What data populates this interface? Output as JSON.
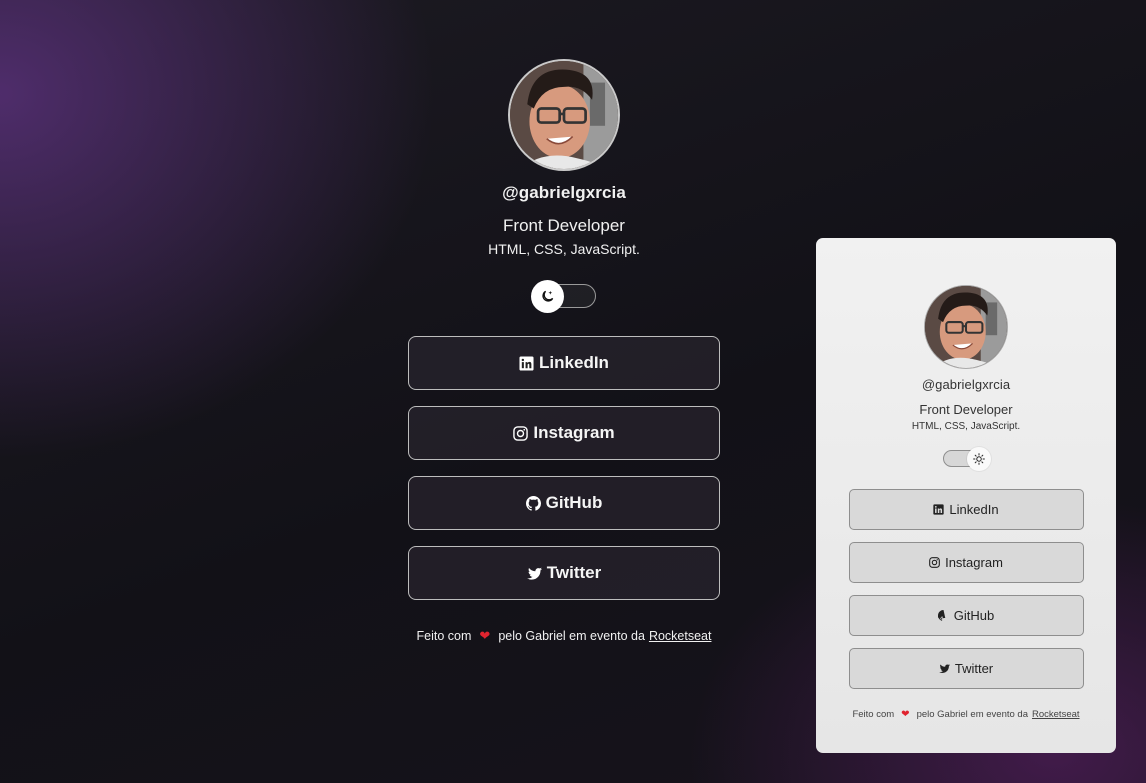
{
  "profile": {
    "handle": "@gabrielgxrcia",
    "role": "Front Developer",
    "stack": "HTML, CSS, JavaScript.",
    "avatar_icon": "avatar-photo"
  },
  "theme_switch": {
    "dark_icon": "moon-stars-icon",
    "light_icon": "sun-icon"
  },
  "links": [
    {
      "label": "LinkedIn",
      "icon": "linkedin-icon"
    },
    {
      "label": "Instagram",
      "icon": "instagram-icon"
    },
    {
      "label": "GitHub",
      "icon": "github-icon"
    },
    {
      "label": "Twitter",
      "icon": "twitter-icon"
    }
  ],
  "footer": {
    "prefix": "Feito com",
    "heart": "❤",
    "middle": "pelo Gabriel em evento da",
    "link": "Rocketseat"
  },
  "colors": {
    "heart": "#e0242f",
    "dark_bg": "#121117",
    "accent_purple": "#583078",
    "card_bg": "#f1f1f1"
  }
}
